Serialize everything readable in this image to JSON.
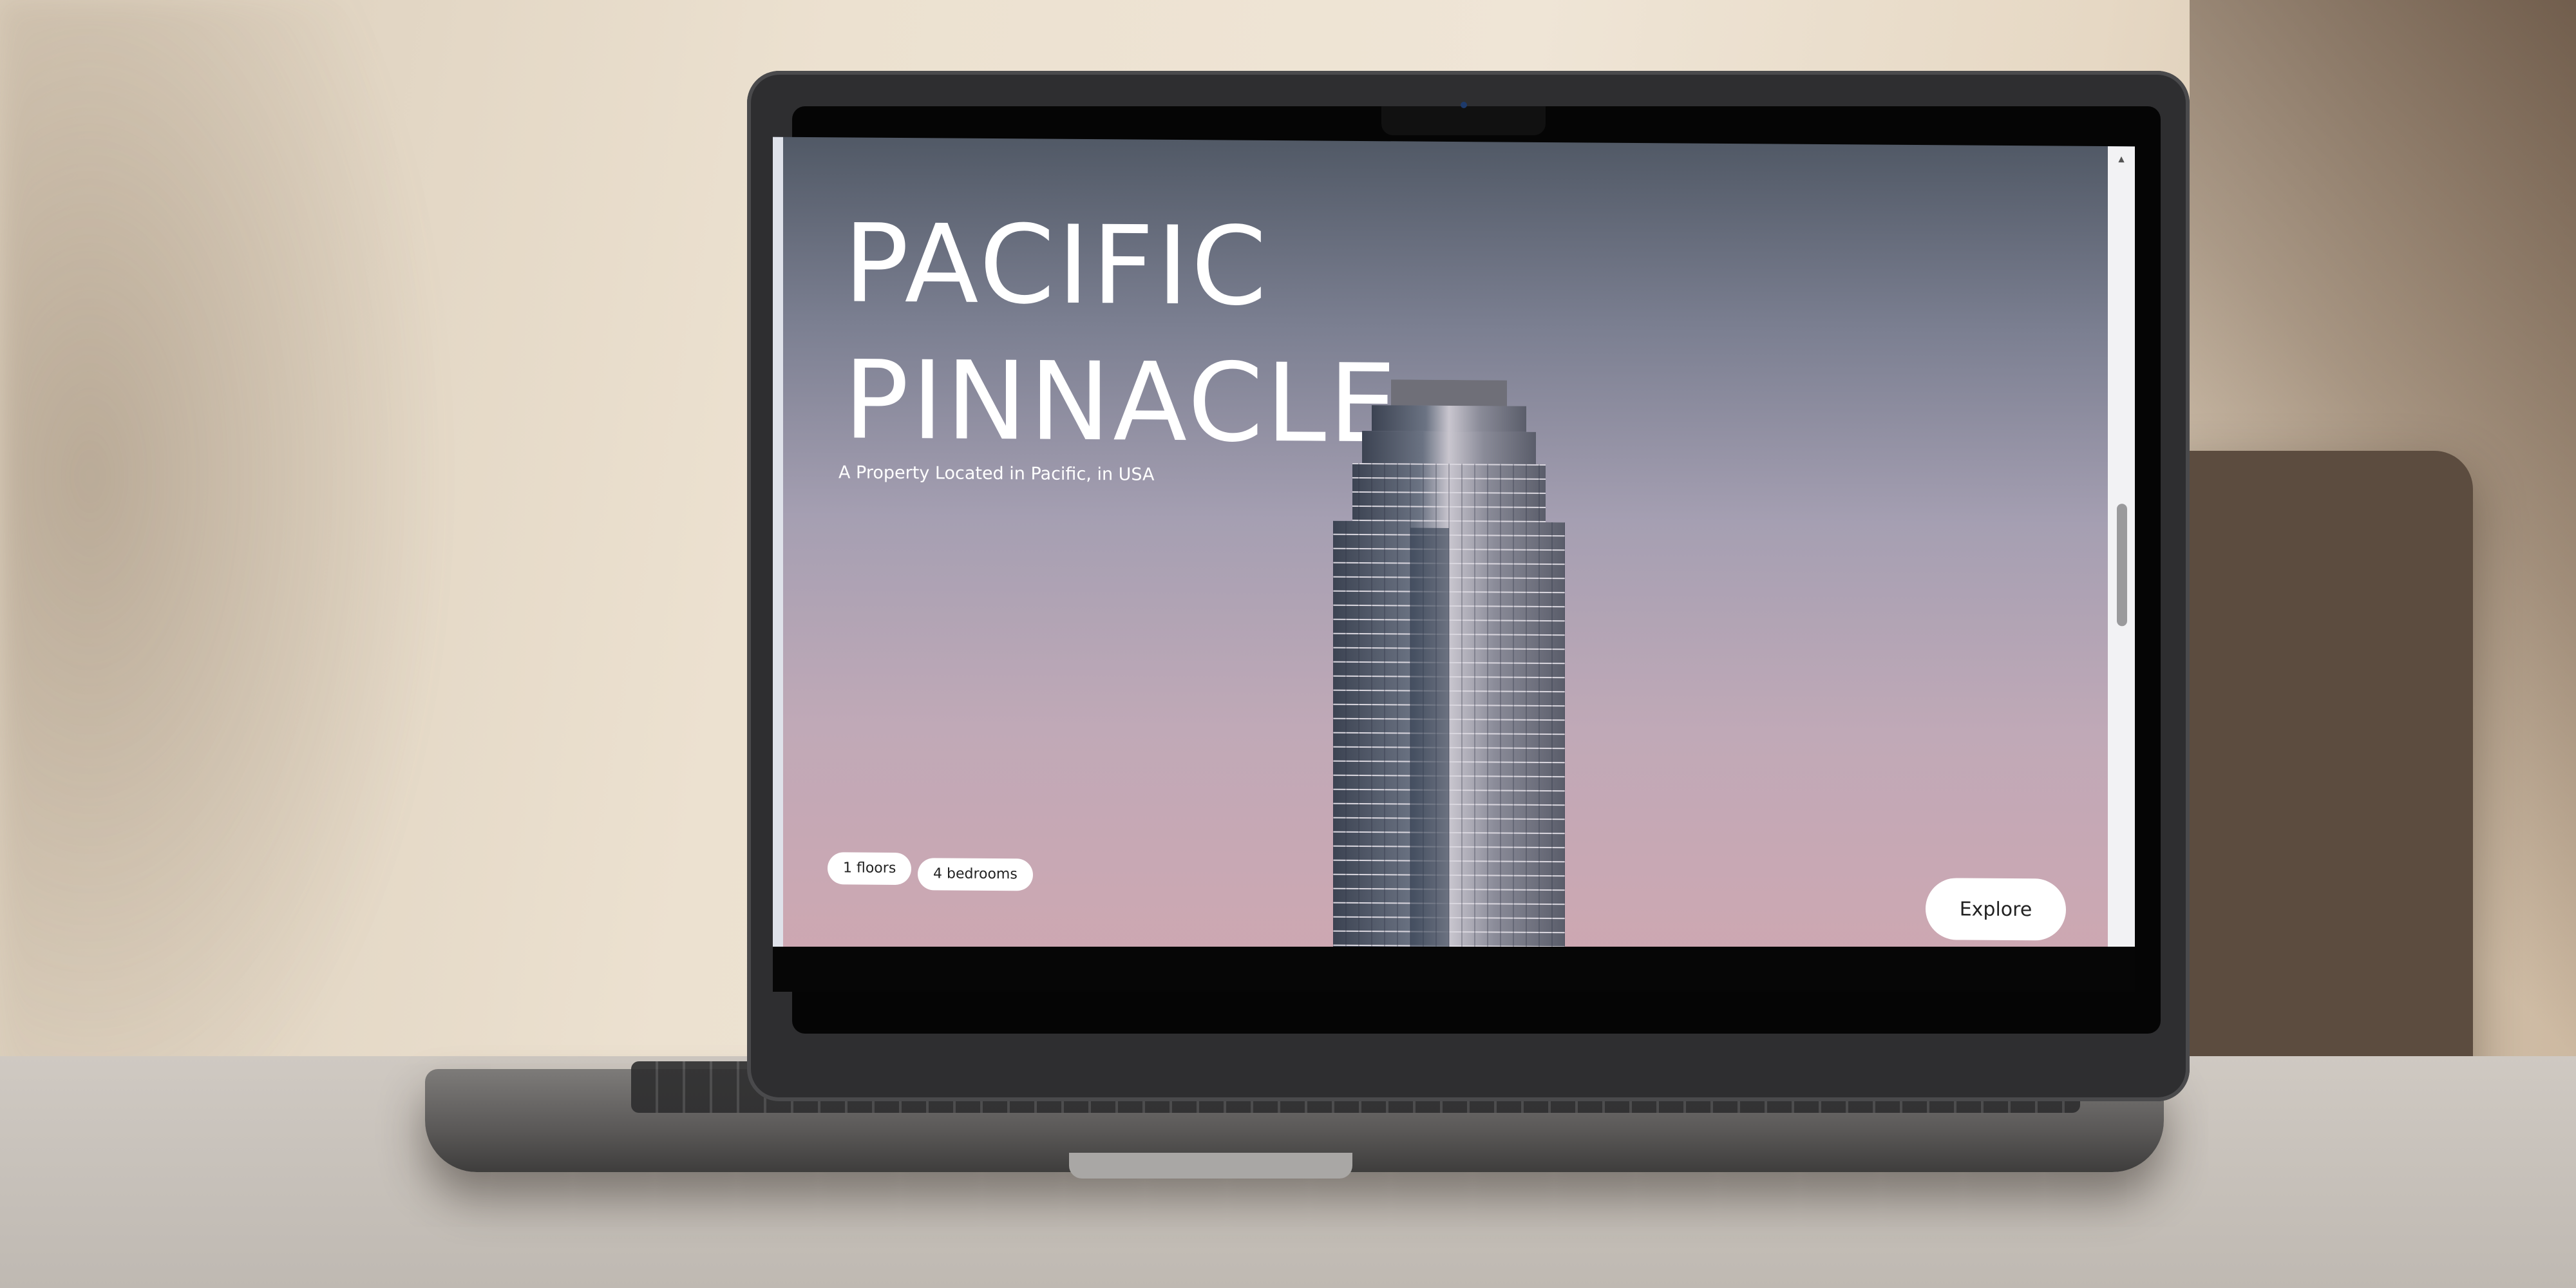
{
  "hero": {
    "title_line1": "PACIFIC",
    "title_line2": "PINNACLE",
    "subtitle": "A Property Located in Pacific, in USA"
  },
  "stats": {
    "floors": "1 floors",
    "bedrooms": "4 bedrooms"
  },
  "actions": {
    "explore_label": "Explore"
  },
  "scrollbar": {
    "up_icon": "chevron-up-icon",
    "down_icon": "chevron-down-icon"
  }
}
